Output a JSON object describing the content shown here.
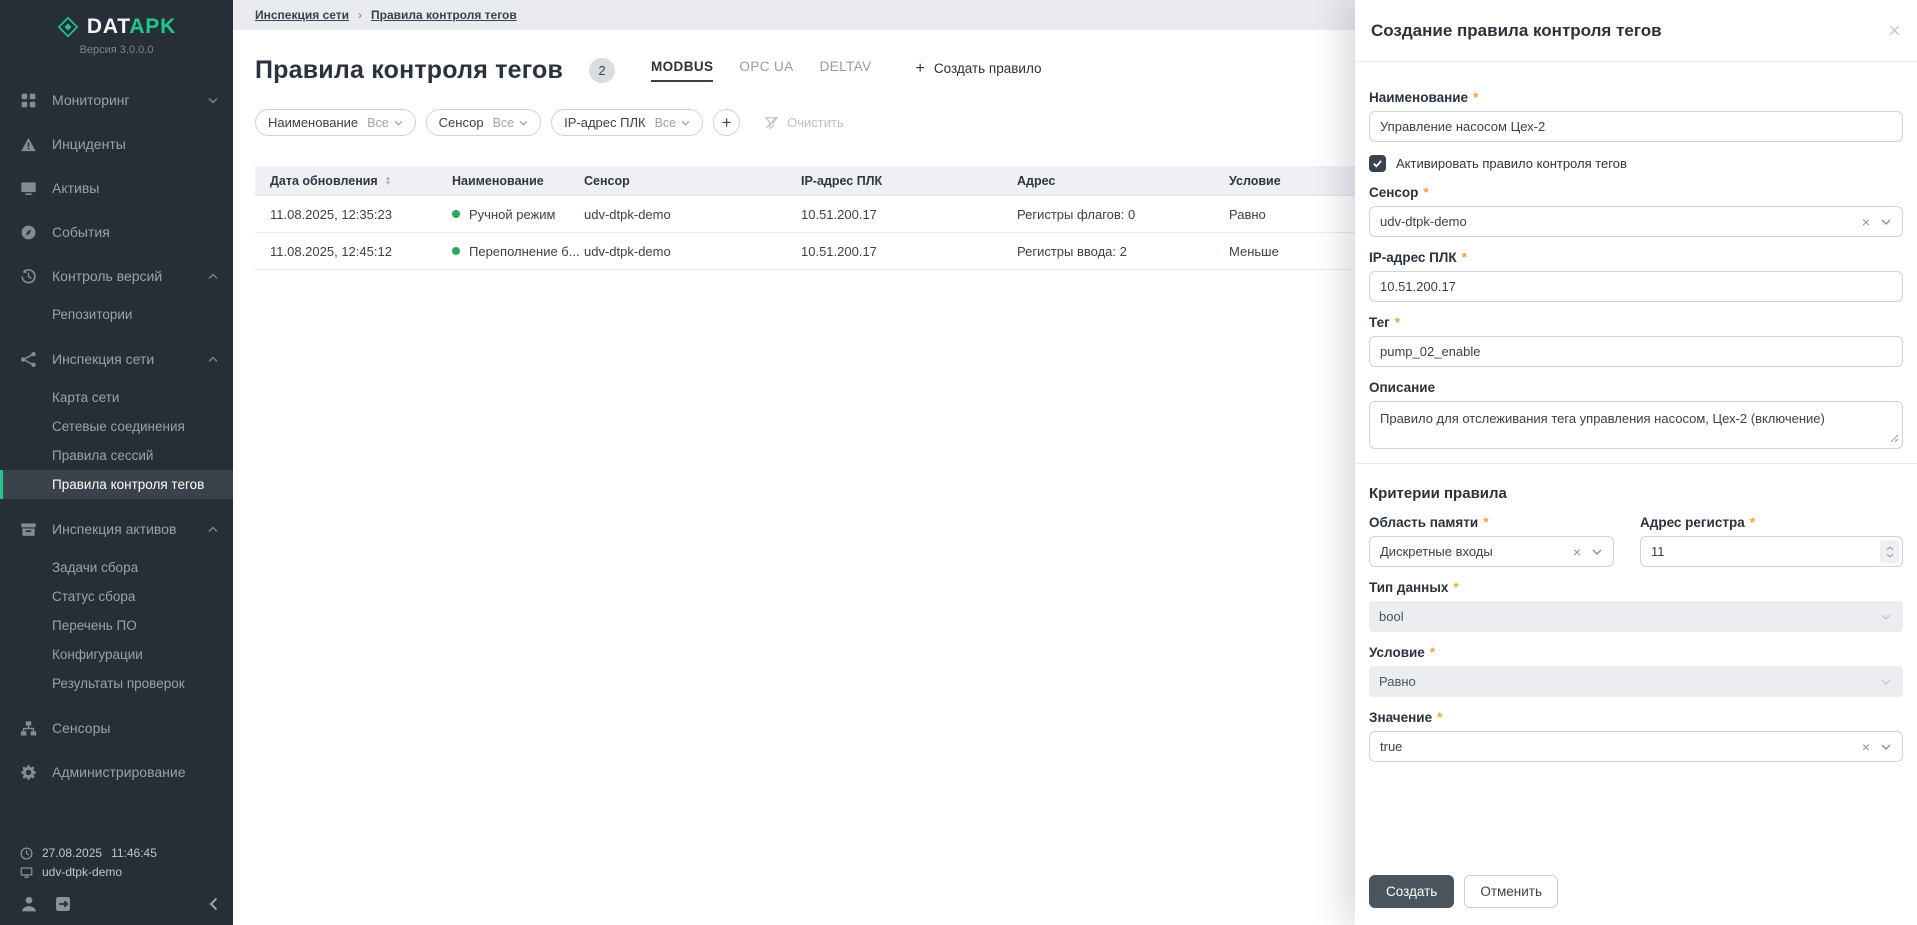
{
  "app": {
    "brand_dat": "DAT",
    "brand_apk": "APK",
    "version": "Версия 3.0.0.0"
  },
  "colors": {
    "accent_green": "#1fc98e",
    "sidebar_bg": "#262e37",
    "status_dot_green": "#2ca75f",
    "required_asterisk": "#f0a43c",
    "primary_button": "#49545f"
  },
  "sidebar": {
    "items": [
      {
        "label": "Мониторинг",
        "icon": "dashboard-icon",
        "chevron": "down"
      },
      {
        "label": "Инциденты",
        "icon": "warning-icon"
      },
      {
        "label": "Активы",
        "icon": "monitor-icon"
      },
      {
        "label": "События",
        "icon": "compass-icon"
      },
      {
        "label": "Контроль версий",
        "icon": "history-icon",
        "chevron": "up",
        "children": [
          "Репозитории"
        ]
      },
      {
        "label": "Инспекция сети",
        "icon": "share-icon",
        "chevron": "up",
        "children": [
          "Карта сети",
          "Сетевые соединения",
          "Правила сессий",
          "Правила контроля тегов"
        ]
      },
      {
        "label": "Инспекция активов",
        "icon": "archive-icon",
        "chevron": "up",
        "children": [
          "Задачи сбора",
          "Статус сбора",
          "Перечень ПО",
          "Конфигурации",
          "Результаты проверок"
        ]
      },
      {
        "label": "Сенсоры",
        "icon": "sitemap-icon"
      },
      {
        "label": "Администрирование",
        "icon": "gear-icon"
      }
    ],
    "active_item": "Правила контроля тегов",
    "status": {
      "date": "27.08.2025",
      "time": "11:46:45",
      "host": "udv-dtpk-demo"
    }
  },
  "breadcrumb": {
    "items": [
      "Инспекция сети",
      "Правила контроля тегов"
    ],
    "separator": "›"
  },
  "main": {
    "title": "Правила контроля тегов",
    "badge": "2",
    "tabs": [
      {
        "label": "MODBUS",
        "active": true
      },
      {
        "label": "OPC UA",
        "active": false
      },
      {
        "label": "DELTAV",
        "active": false
      }
    ],
    "create_button": "Создать правило",
    "filters": [
      {
        "label": "Наименование",
        "value": "Все"
      },
      {
        "label": "Сенсор",
        "value": "Все"
      },
      {
        "label": "IP-адрес ПЛК",
        "value": "Все"
      }
    ],
    "clear_button": "Очистить",
    "table": {
      "columns": [
        "Дата обновления",
        "Наименование",
        "Сенсор",
        "IP-адрес ПЛК",
        "Адрес",
        "Условие"
      ],
      "rows": [
        {
          "updated": "11.08.2025, 12:35:23",
          "status": "green",
          "name": "Ручной режим",
          "sensor": "udv-dtpk-demo",
          "ip": "10.51.200.17",
          "address": "Регистры флагов: 0",
          "condition": "Равно"
        },
        {
          "updated": "11.08.2025, 12:45:12",
          "status": "green",
          "name": "Переполнение б...",
          "sensor": "udv-dtpk-demo",
          "ip": "10.51.200.17",
          "address": "Регистры ввода: 2",
          "condition": "Меньше"
        }
      ]
    }
  },
  "panel": {
    "title": "Создание правила контроля тегов",
    "required_marker": "*",
    "criteria_heading": "Критерии правила",
    "fields": {
      "name": {
        "label": "Наименование",
        "value": "Управление насосом Цех-2",
        "required": true
      },
      "activate": {
        "label": "Активировать правило контроля тегов",
        "checked": true
      },
      "sensor": {
        "label": "Сенсор",
        "value": "udv-dtpk-demo",
        "required": true
      },
      "ip": {
        "label": "IP-адрес ПЛК",
        "value": "10.51.200.17",
        "required": true
      },
      "tag": {
        "label": "Тег",
        "value": "pump_02_enable",
        "required": true
      },
      "description": {
        "label": "Описание",
        "value": "Правило для отслеживания тега управления насосом, Цех-2 (включение)"
      },
      "memory_area": {
        "label": "Область памяти",
        "value": "Дискретные входы",
        "required": true
      },
      "register_address": {
        "label": "Адрес регистра",
        "value": "11",
        "required": true
      },
      "data_type": {
        "label": "Тип данных",
        "value": "bool",
        "required": true,
        "disabled": true
      },
      "condition": {
        "label": "Условие",
        "value": "Равно",
        "required": true,
        "disabled": true
      },
      "value": {
        "label": "Значение",
        "value": "true",
        "required": true
      }
    },
    "buttons": {
      "create": "Создать",
      "cancel": "Отменить"
    }
  }
}
